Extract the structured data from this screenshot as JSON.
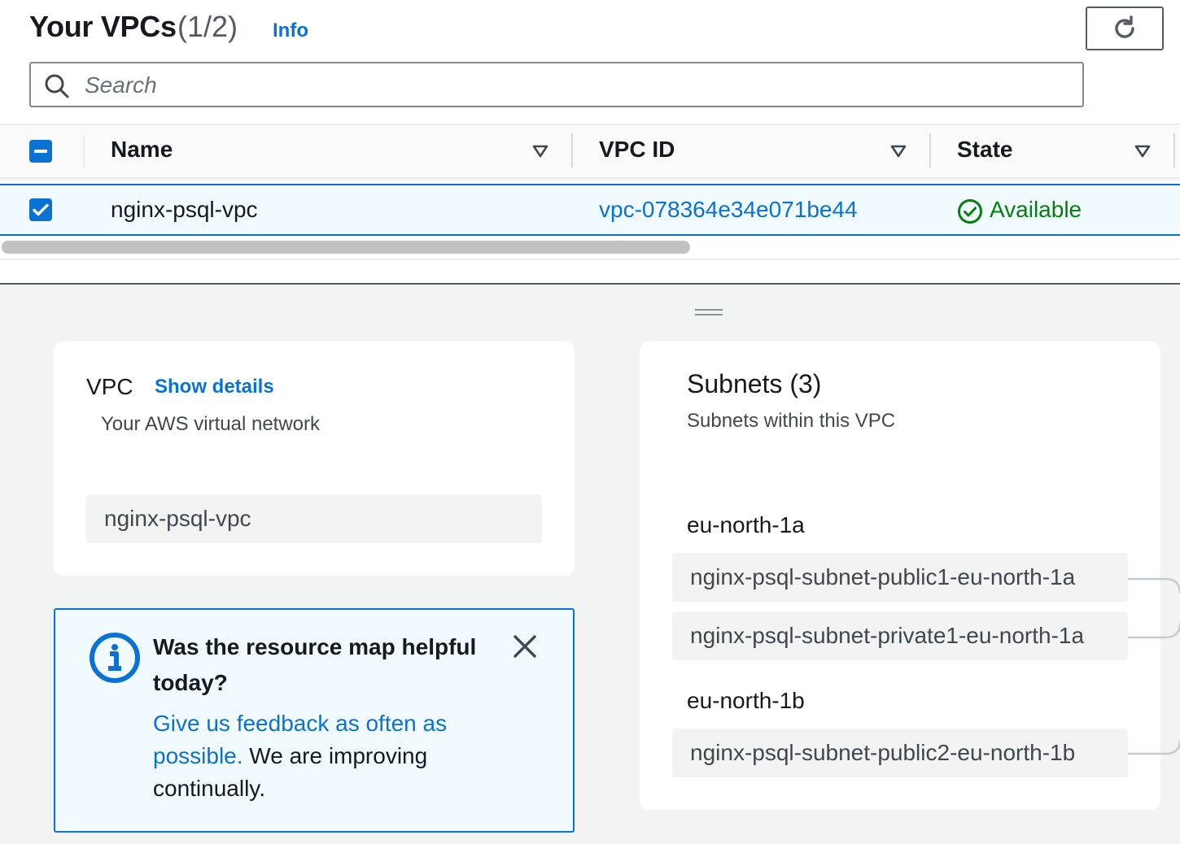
{
  "header": {
    "title": "Your VPCs",
    "count": "(1/2)",
    "info_link": "Info",
    "refresh_icon": "refresh-icon"
  },
  "search": {
    "placeholder": "Search",
    "value": ""
  },
  "table": {
    "columns": [
      "Name",
      "VPC ID",
      "State"
    ],
    "select_all_state": "indeterminate",
    "rows": [
      {
        "selected": true,
        "name": "nginx-psql-vpc",
        "vpc_id": "vpc-078364e34e071be44",
        "state": "Available",
        "state_icon": "check-circle-icon"
      }
    ]
  },
  "resource_map": {
    "vpc": {
      "title": "VPC",
      "show_details": "Show details",
      "description": "Your AWS virtual network",
      "name": "nginx-psql-vpc"
    },
    "subnets": {
      "title": "Subnets (3)",
      "description": "Subnets within this VPC",
      "zones": [
        {
          "name": "eu-north-1a",
          "subnets": [
            "nginx-psql-subnet-public1-eu-north-1a",
            "nginx-psql-subnet-private1-eu-north-1a"
          ]
        },
        {
          "name": "eu-north-1b",
          "subnets": [
            "nginx-psql-subnet-public2-eu-north-1b"
          ]
        }
      ]
    }
  },
  "feedback_alert": {
    "title": "Was the resource map helpful today?",
    "link_text": "Give us feedback as often as possible.",
    "body_text": " We are improving continually.",
    "icon": "info-icon",
    "close_icon": "close-icon"
  },
  "colors": {
    "link": "#0972d3",
    "success": "#037f0c",
    "selected_row_bg": "#f1faff",
    "panel_bg": "#f2f3f3"
  }
}
